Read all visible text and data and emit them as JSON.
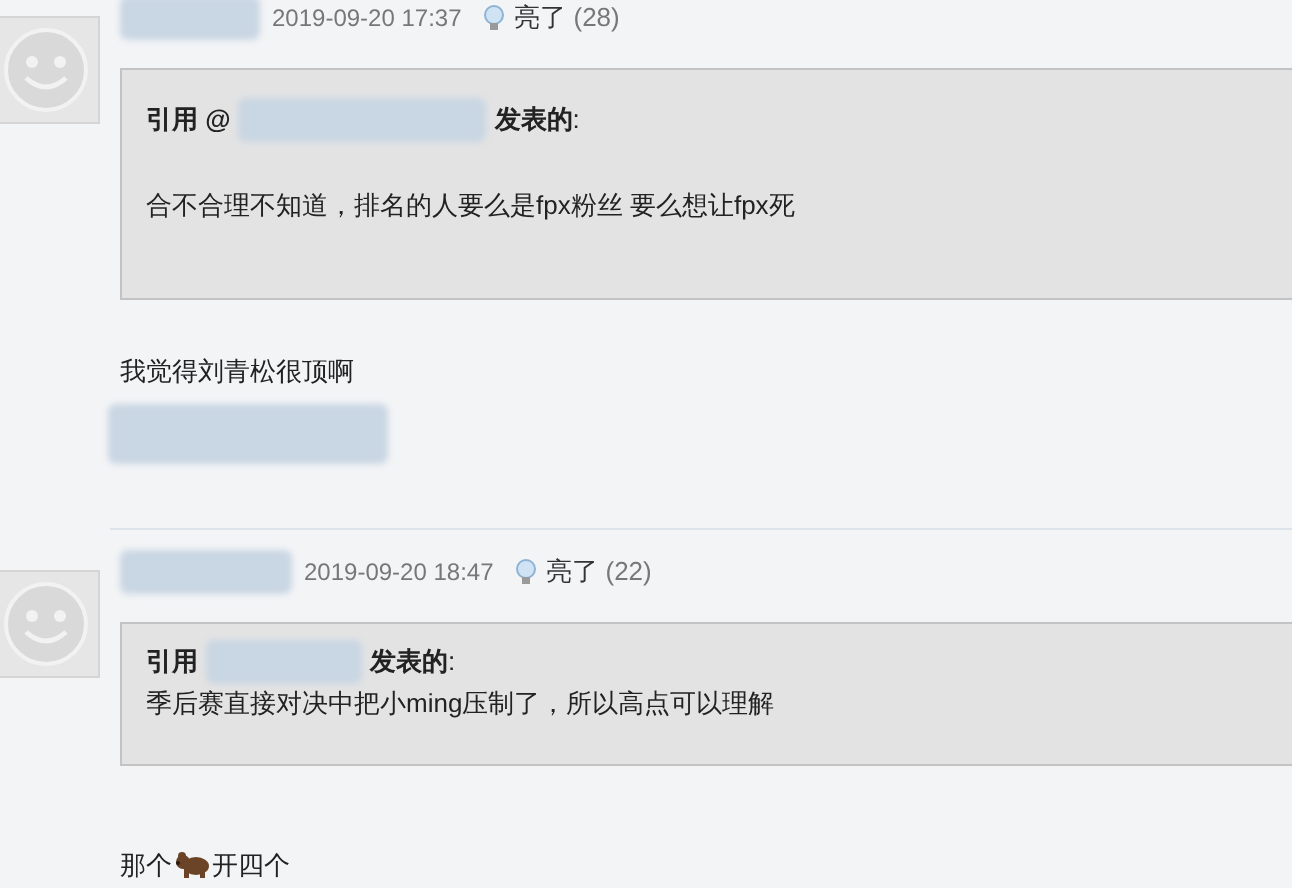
{
  "posts": [
    {
      "time": "2019-09-20 17:37",
      "light_label": "亮了",
      "light_count": "(28)",
      "quote": {
        "prefix": "引用 @",
        "suffix": "发表的",
        "colon": ":",
        "text": "合不合理不知道，排名的人要么是fpx粉丝  要么想让fpx死"
      },
      "reply_parts": [
        "我觉得刘青松很顶啊"
      ]
    },
    {
      "time": "2019-09-20 18:47",
      "light_label": "亮了",
      "light_count": "(22)",
      "quote": {
        "prefix": "引用",
        "suffix": "发表的",
        "colon": ":",
        "text": "季后赛直接对决中把小ming压制了，所以高点可以理解"
      },
      "reply_parts": [
        "那个",
        "开四个"
      ]
    }
  ]
}
